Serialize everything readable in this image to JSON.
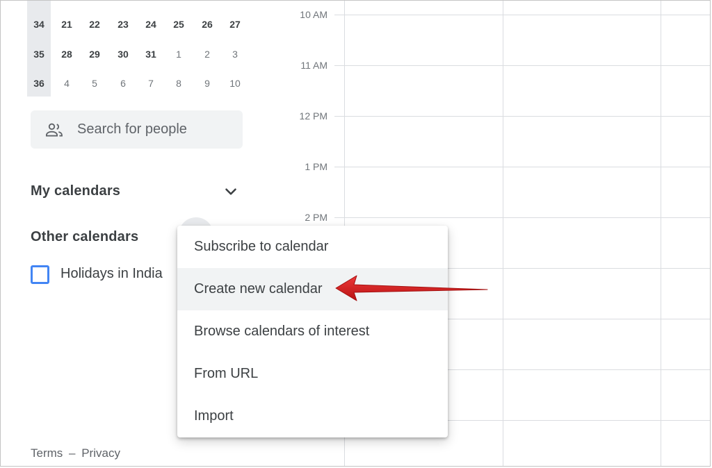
{
  "mini_calendar": {
    "rows": [
      {
        "week": "34",
        "days": [
          "21",
          "22",
          "23",
          "24",
          "25",
          "26",
          "27"
        ]
      },
      {
        "week": "35",
        "days": [
          "28",
          "29",
          "30",
          "31",
          "1",
          "2",
          "3"
        ]
      },
      {
        "week": "36",
        "days": [
          "4",
          "5",
          "6",
          "7",
          "8",
          "9",
          "10"
        ]
      }
    ]
  },
  "search": {
    "placeholder": "Search for people",
    "icon": "people-icon"
  },
  "my_calendars": {
    "title": "My calendars",
    "icon": "chevron-down-icon"
  },
  "other_calendars": {
    "title": "Other calendars",
    "items": [
      {
        "label": "Holidays in India",
        "checked": false,
        "color": "#4285f4"
      }
    ]
  },
  "footer": {
    "terms": "Terms",
    "separator": "–",
    "privacy": "Privacy"
  },
  "time_labels": [
    "10 AM",
    "11 AM",
    "12 PM",
    "1 PM",
    "2 PM"
  ],
  "menu": {
    "items": [
      {
        "label": "Subscribe to calendar",
        "highlighted": false
      },
      {
        "label": "Create new calendar",
        "highlighted": true
      },
      {
        "label": "Browse calendars of interest",
        "highlighted": false
      },
      {
        "label": "From URL",
        "highlighted": false
      },
      {
        "label": "Import",
        "highlighted": false
      }
    ]
  },
  "colors": {
    "accent": "#4285f4",
    "annotation_arrow": "#d81b1b",
    "hover_bg": "#f1f3f4"
  }
}
